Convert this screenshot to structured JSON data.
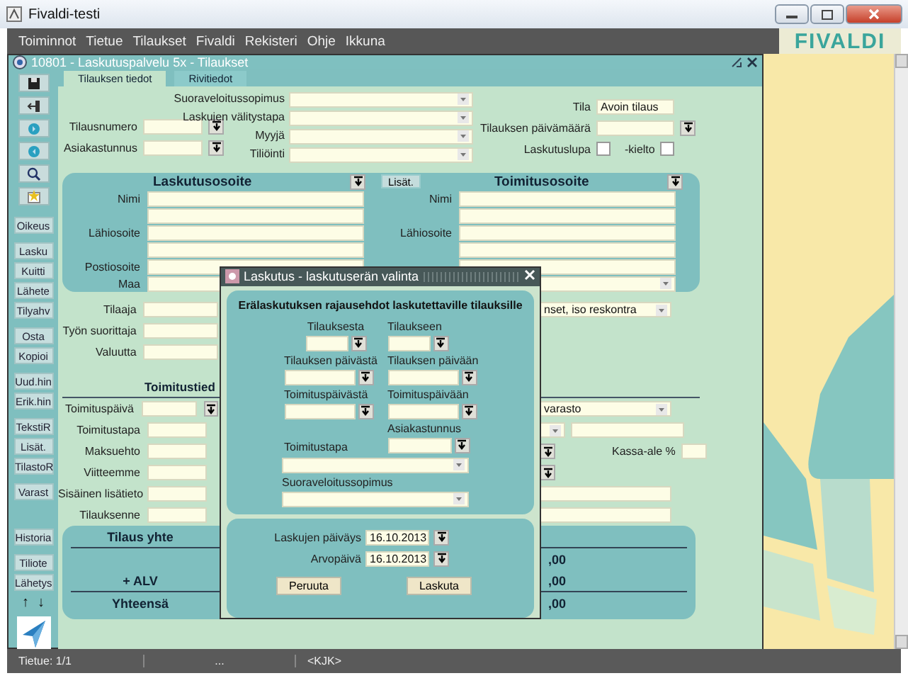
{
  "window": {
    "title": "Fivaldi-testi"
  },
  "menu": [
    {
      "label": "Toiminnot"
    },
    {
      "label": "Tietue"
    },
    {
      "label": "Tilaukset"
    },
    {
      "label": "Fivaldi"
    },
    {
      "label": "Rekisteri"
    },
    {
      "label": "Ohje"
    },
    {
      "label": "Ikkuna"
    }
  ],
  "logo": "FIVALDI",
  "form_window": {
    "title": "10801 - Laskutuspalvelu 5x - Tilaukset"
  },
  "toolbar_groups": [
    [
      "Oikeus"
    ],
    [
      "Lasku",
      "Kuitti",
      "Lähete",
      "Tilyahv"
    ],
    [
      "Osta",
      "Kopioi"
    ],
    [
      "Uud.hin",
      "Erik.hin"
    ],
    [
      "TekstiR",
      "Lisät.",
      "TilastoR"
    ],
    [
      "Varast"
    ],
    [
      "Historia"
    ],
    [
      "Tiliote",
      "Lähetys"
    ]
  ],
  "toolbar_arrows": [
    "↑",
    "↓"
  ],
  "tabs": [
    {
      "label": "Tilauksen tiedot",
      "selected": true
    },
    {
      "label": "Rivitiedot",
      "selected": false
    }
  ],
  "header": {
    "order_fields": [
      {
        "label": "Tilausnumero",
        "kind": "picker"
      },
      {
        "label": "Asiakastunnus",
        "kind": "picker"
      }
    ],
    "dropdowns": [
      {
        "label": "Suoraveloitussopimus"
      },
      {
        "label": "Laskujen välitystapa"
      },
      {
        "label": "Myyjä"
      },
      {
        "label": "Tiliöinti"
      }
    ],
    "status_fields": [
      {
        "label": "Tila",
        "kind": "text",
        "value": "Avoin tilaus"
      },
      {
        "label": "Tilauksen päivämäärä",
        "kind": "picker"
      }
    ],
    "permissions": [
      {
        "label": "Laskutuslupa",
        "checked": false
      },
      {
        "label": "-kielto",
        "checked": false
      }
    ]
  },
  "billing_address": {
    "title": "Laskutusosoite",
    "rows": [
      {
        "kind": "text",
        "label": "Nimi"
      },
      {
        "kind": "text"
      },
      {
        "kind": "text",
        "label": "Lähiosoite"
      },
      {
        "kind": "text"
      },
      {
        "kind": "text",
        "label": "Postiosoite"
      },
      {
        "kind": "text",
        "label": "Maa"
      }
    ]
  },
  "delivery_address": {
    "button": "Lisät.",
    "title": "Toimitusosoite",
    "rows": [
      {
        "kind": "text",
        "label": "Nimi"
      },
      {
        "kind": "text"
      },
      {
        "kind": "text",
        "label": "Lähiosoite"
      },
      {
        "kind": "text"
      },
      {
        "kind": "text"
      },
      {
        "kind": "dropdown"
      }
    ]
  },
  "customer_rows": [
    {
      "label": "Tilaaja"
    },
    {
      "label": "Työn suorittaja"
    },
    {
      "label": "Valuutta"
    }
  ],
  "ledger_dropdown": {
    "value": "nset, iso reskontra"
  },
  "delivery": {
    "title": "Toimitustied",
    "rows": [
      {
        "label": "Toimituspäivä",
        "kind": "picker",
        "right": {
          "kind": "dropdown",
          "value": "varasto"
        }
      },
      {
        "label": "Toimitustapa",
        "kind": "text",
        "right": {
          "kind": "dropdown_text"
        }
      },
      {
        "label": "Maksuehto",
        "kind": "text",
        "right": {
          "kind": "picker_discount",
          "label": "Kassa-ale %"
        }
      },
      {
        "label": "Viitteemme",
        "kind": "text",
        "right": {
          "kind": "picker"
        }
      },
      {
        "label": "Sisäinen lisätieto",
        "kind": "text",
        "right": {
          "kind": "text"
        }
      },
      {
        "label": "Tilauksenne",
        "kind": "text",
        "right": {
          "kind": "text"
        }
      }
    ]
  },
  "totals": {
    "title": "Tilaus yhte",
    "rows": [
      {
        "value": ",00"
      },
      {
        "label": "+ ALV",
        "value": ",00"
      },
      {
        "label": "Yhteensä",
        "value": ",00"
      }
    ]
  },
  "dialog": {
    "title": "Laskutus - laskutuserän valinta",
    "heading": "Erälaskutuksen rajausehdot laskutettaville tilauksille",
    "ranges": [
      {
        "from": "Tilauksesta",
        "to": "Tilaukseen"
      },
      {
        "from": "Tilauksen päivästä",
        "to": "Tilauksen päivään"
      },
      {
        "from": "Toimituspäivästä",
        "to": "Toimituspäivään"
      }
    ],
    "customer": {
      "label": "Asiakastunnus"
    },
    "dropdowns": [
      {
        "label": "Toimitustapa"
      },
      {
        "label": "Suoraveloitussopimus"
      }
    ],
    "dates": [
      {
        "label": "Laskujen päiväys",
        "value": "16.10.2013"
      },
      {
        "label": "Arvopäivä",
        "value": "16.10.2013"
      }
    ],
    "buttons": [
      "Peruuta",
      "Laskuta"
    ]
  },
  "status_bar": [
    "Tietue: 1/1",
    "...",
    "<KJK>"
  ]
}
